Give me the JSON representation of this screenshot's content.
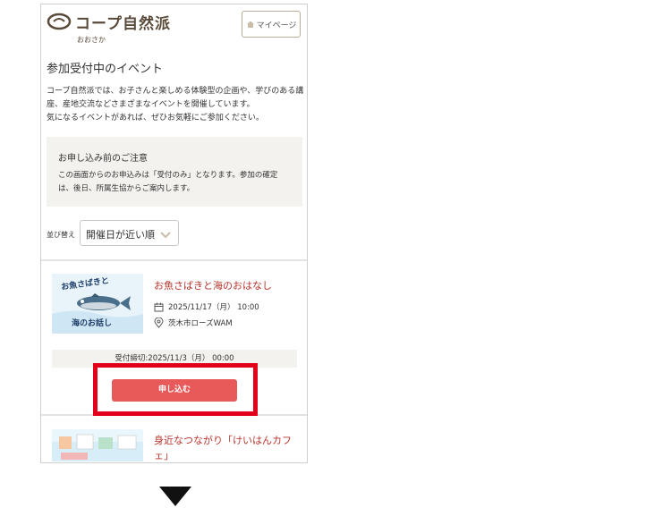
{
  "header": {
    "logo_text": "コープ自然派",
    "logo_sub": "おおさか",
    "mypage_label": "マイページ"
  },
  "page": {
    "title": "参加受付中のイベント",
    "intro": "コープ自然派では、お子さんと楽しめる体験型の企画や、学びのある講座、産地交流などさまざまなイベントを開催しています。\n気になるイベントがあれば、ぜひお気軽にご参加ください。"
  },
  "notice": {
    "title": "お申し込み前のご注意",
    "body": "この画面からのお申込みは「受付のみ」となります。参加の確定は、後日、所属生協からご案内します。"
  },
  "sort": {
    "label": "並び替え",
    "selected": "開催日が近い順"
  },
  "events": [
    {
      "title": "お魚さばきと海のおはなし",
      "thumb_text": "お魚さばきと海のお話し",
      "date": "2025/11/17（月） 10:00",
      "place": "茨木市ローズWAM",
      "deadline": "受付締切:2025/11/3（月） 00:00",
      "apply_label": "申し込む"
    },
    {
      "title": "身近なつながり「けいはんカフェ」"
    }
  ],
  "colors": {
    "accent_red": "#b8342c",
    "button": "#e85a5a",
    "highlight": "#e3001b"
  }
}
